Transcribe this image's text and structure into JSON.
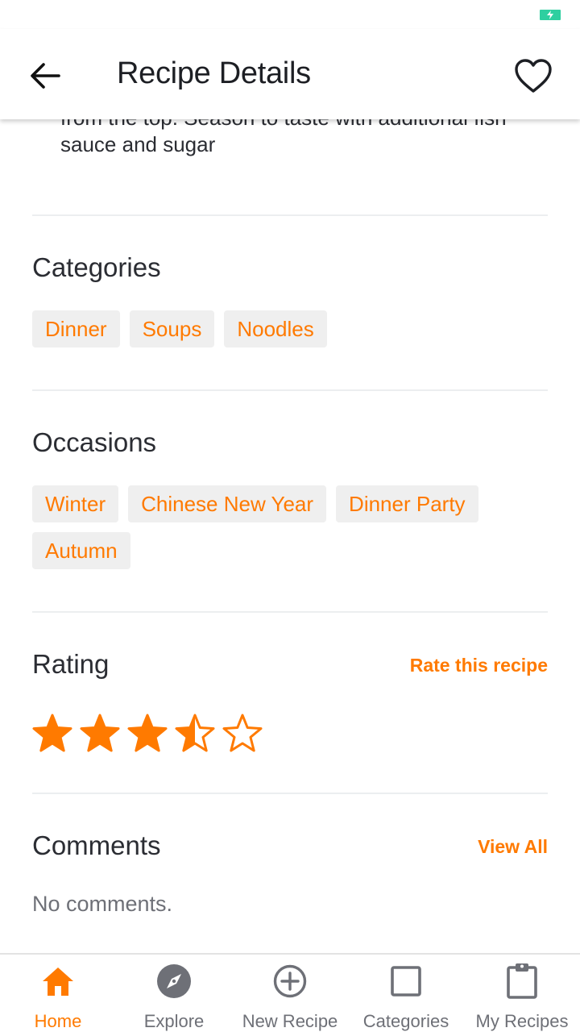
{
  "header": {
    "title": "Recipe Details"
  },
  "instructions": {
    "tail_text": "from the top. Season to taste with additional fish sauce and sugar"
  },
  "categories": {
    "title": "Categories",
    "items": [
      "Dinner",
      "Soups",
      "Noodles"
    ]
  },
  "occasions": {
    "title": "Occasions",
    "items": [
      "Winter",
      "Chinese New Year",
      "Dinner Party",
      "Autumn"
    ]
  },
  "rating": {
    "title": "Rating",
    "action_label": "Rate this recipe",
    "value": 3.5,
    "max": 5
  },
  "comments": {
    "title": "Comments",
    "action_label": "View All",
    "empty_text": "No comments."
  },
  "bottom_nav": {
    "items": [
      {
        "label": "Home",
        "icon": "home-icon",
        "active": true
      },
      {
        "label": "Explore",
        "icon": "compass-icon",
        "active": false
      },
      {
        "label": "New Recipe",
        "icon": "add-circle-icon",
        "active": false
      },
      {
        "label": "Categories",
        "icon": "square-icon",
        "active": false
      },
      {
        "label": "My Recipes",
        "icon": "clipboard-icon",
        "active": false
      }
    ]
  },
  "colors": {
    "accent": "#ff7a00",
    "text": "#2b2d33",
    "chip_background": "#efefef",
    "inactive": "#6e7077",
    "battery": "#2ecfa0"
  }
}
